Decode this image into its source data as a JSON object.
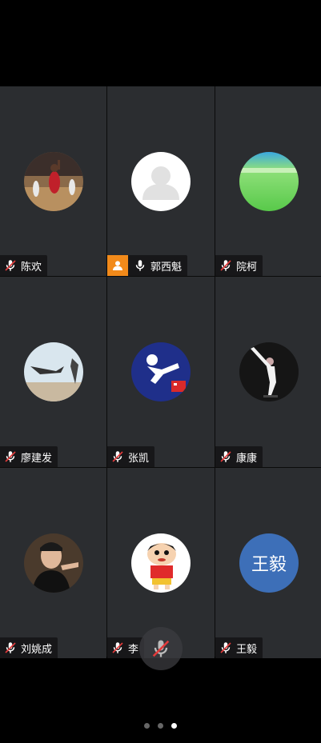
{
  "participants": [
    {
      "name": "陈欢",
      "avatar": "photo-basketball-player",
      "muted": true,
      "host": false
    },
    {
      "name": "郭西魁",
      "avatar": "default-user",
      "muted": false,
      "host": true
    },
    {
      "name": "院柯",
      "avatar": "photo-green-field",
      "muted": true,
      "host": false
    },
    {
      "name": "廖建发",
      "avatar": "photo-jumping-person",
      "muted": true,
      "host": false
    },
    {
      "name": "张凯",
      "avatar": "logo-karate",
      "muted": true,
      "host": false
    },
    {
      "name": "康康",
      "avatar": "photo-taekwondo-kick",
      "muted": true,
      "host": false
    },
    {
      "name": "刘姚成",
      "avatar": "photo-man-pointing",
      "muted": true,
      "host": false
    },
    {
      "name": "李",
      "avatar": "cartoon-boy",
      "muted": true,
      "host": false
    },
    {
      "name": "王毅",
      "avatar": "text-avatar",
      "avatar_text": "王毅",
      "avatar_color": "#3d6fb8",
      "muted": true,
      "host": false
    }
  ],
  "colors": {
    "tile_bg": "#2b2d30",
    "host_badge": "#f28a1a",
    "muted_slash": "#e23b3b"
  },
  "pager": {
    "count": 3,
    "active": 3
  }
}
